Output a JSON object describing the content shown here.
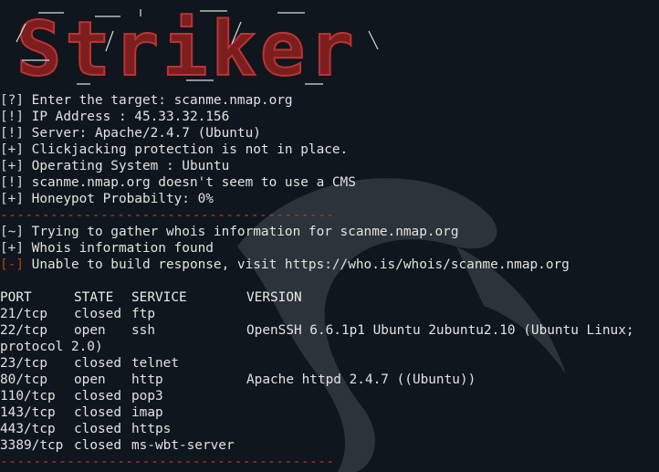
{
  "banner": {
    "logo_text": "Striker"
  },
  "intro": [
    {
      "tag": "[?]",
      "text": " Enter the target: scanme.nmap.org"
    },
    {
      "tag": "[!]",
      "text": " IP Address : 45.33.32.156"
    },
    {
      "tag": "[!]",
      "text": " Server: Apache/2.4.7 (Ubuntu)"
    },
    {
      "tag": "[+]",
      "text": " Clickjacking protection is not in place."
    },
    {
      "tag": "[+]",
      "text": " Operating System : Ubuntu"
    },
    {
      "tag": "[!]",
      "text": " scanme.nmap.org doesn't seem to use a CMS"
    },
    {
      "tag": "[+]",
      "text": " Honeypot Probabilty: 0%"
    }
  ],
  "separator": "----------------------------------------",
  "whois": [
    {
      "tag": "[~]",
      "text": " Trying to gather whois information for scanme.nmap.org"
    },
    {
      "tag": "[+]",
      "text": " Whois information found"
    },
    {
      "tag": "[-]",
      "text": " Unable to build response, visit https://who.is/whois/scanme.nmap.org"
    }
  ],
  "ports": {
    "headers": {
      "port": "PORT",
      "state": "STATE",
      "service": "SERVICE",
      "version": "VERSION"
    },
    "rows": [
      {
        "port": "21/tcp",
        "state": "closed",
        "service": "ftp",
        "version": ""
      },
      {
        "port": "22/tcp",
        "state": "open",
        "service": "ssh",
        "version": "OpenSSH 6.6.1p1 Ubuntu 2ubuntu2.10 (Ubuntu Linux;"
      },
      {
        "continuation": "protocol 2.0)"
      },
      {
        "port": "23/tcp",
        "state": "closed",
        "service": "telnet",
        "version": ""
      },
      {
        "port": "80/tcp",
        "state": "open",
        "service": "http",
        "version": "Apache httpd 2.4.7 ((Ubuntu))"
      },
      {
        "port": "110/tcp",
        "state": "closed",
        "service": "pop3",
        "version": ""
      },
      {
        "port": "143/tcp",
        "state": "closed",
        "service": "imap",
        "version": ""
      },
      {
        "port": "443/tcp",
        "state": "closed",
        "service": "https",
        "version": ""
      },
      {
        "port": "3389/tcp",
        "state": "closed",
        "service": "ms-wbt-server",
        "version": ""
      }
    ]
  },
  "colors": {
    "background": "#0f161d",
    "text": "#e2e2e2",
    "accent_red": "#c0392b"
  }
}
